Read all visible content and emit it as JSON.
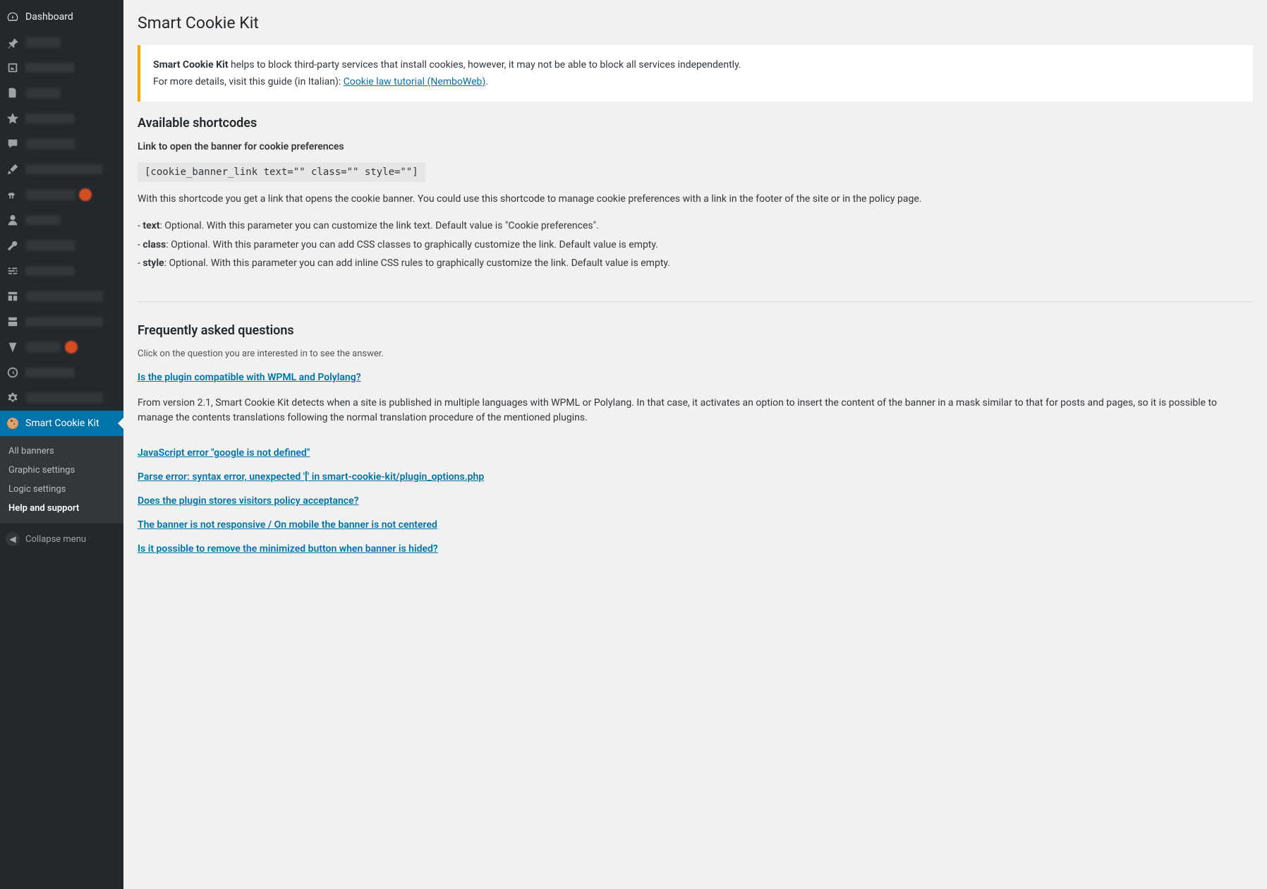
{
  "sidebar": {
    "dashboard_label": "Dashboard",
    "active_item_label": "Smart Cookie Kit",
    "submenu": {
      "all_banners": "All banners",
      "graphic_settings": "Graphic settings",
      "logic_settings": "Logic settings",
      "help_support": "Help and support"
    },
    "collapse_label": "Collapse menu"
  },
  "page": {
    "title": "Smart Cookie Kit",
    "notice": {
      "bold_lead": "Smart Cookie Kit",
      "para1_rest": " helps to block third-party services that install cookies, however, it may not be able to block all services independently.",
      "para2_lead": "For more details, visit this guide (in Italian): ",
      "link_text": "Cookie law tutorial (NemboWeb)",
      "trail": "."
    },
    "shortcodes": {
      "heading": "Available shortcodes",
      "sub1": "Link to open the banner for cookie preferences",
      "code1": "[cookie_banner_link text=\"\" class=\"\" style=\"\"]",
      "desc1": "With this shortcode you get a link that opens the cookie banner. You could use this shortcode to manage cookie preferences with a link in the footer of the site or in the policy page.",
      "params": [
        {
          "dash": "- ",
          "name": "text",
          "rest": ": Optional. With this parameter you can customize the link text. Default value is \"Cookie preferences\"."
        },
        {
          "dash": "- ",
          "name": "class",
          "rest": ": Optional. With this parameter you can add CSS classes to graphically customize the link. Default value is empty."
        },
        {
          "dash": "- ",
          "name": "style",
          "rest": ": Optional. With this parameter you can add inline CSS rules to graphically customize the link. Default value is empty."
        }
      ]
    },
    "faq": {
      "heading": "Frequently asked questions",
      "hint": "Click on the question you are interested in to see the answer.",
      "q1": "Is the plugin compatible with WPML and Polylang?",
      "a1": "From version 2.1, Smart Cookie Kit detects when a site is published in multiple languages with WPML or Polylang. In that case, it activates an option to insert the content of the banner in a mask similar to that for posts and pages, so it is possible to manage the contents translations following the normal translation procedure of the mentioned plugins.",
      "q2": "JavaScript error \"google is not defined\"",
      "q3": "Parse error: syntax error, unexpected '[' in smart-cookie-kit/plugin_options.php",
      "q4": "Does the plugin stores visitors policy acceptance?",
      "q5": "The banner is not responsive / On mobile the banner is not centered",
      "q6": "Is it possible to remove the minimized button when banner is hided?"
    }
  }
}
